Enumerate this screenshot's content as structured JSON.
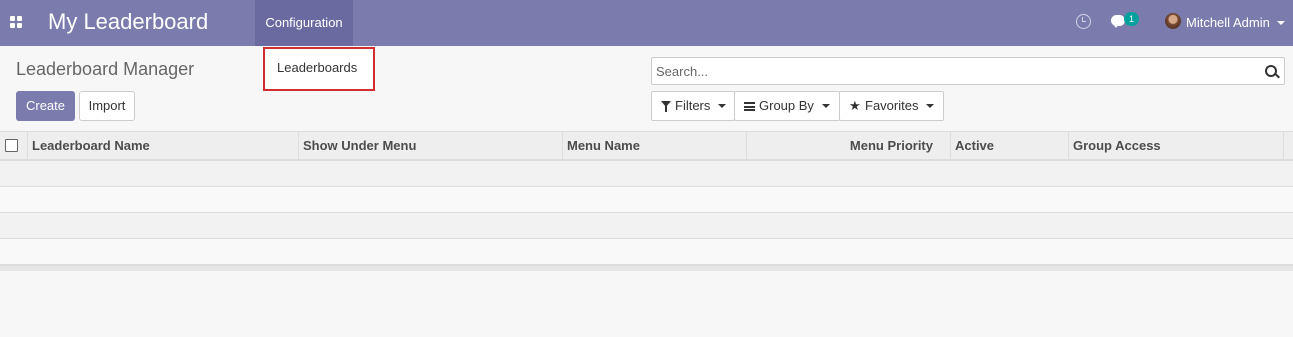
{
  "navbar": {
    "app_title": "My Leaderboard",
    "menu_config": "Configuration",
    "chat_badge": "1",
    "user_name": "Mitchell Admin"
  },
  "dropdown": {
    "items": [
      {
        "label": "Leaderboards"
      }
    ]
  },
  "control_panel": {
    "breadcrumb": "Leaderboard Manager",
    "create_label": "Create",
    "import_label": "Import",
    "search_placeholder": "Search...",
    "filters_label": "Filters",
    "group_by_label": "Group By",
    "favorites_label": "Favorites"
  },
  "table": {
    "columns": [
      "Leaderboard Name",
      "Show Under Menu",
      "Menu Name",
      "Menu Priority",
      "Active",
      "Group Access"
    ],
    "rows": [
      [],
      [],
      [],
      []
    ]
  },
  "colors": {
    "brand": "#7c7bad",
    "highlight": "#d12f2f",
    "badge": "#00a09d"
  }
}
